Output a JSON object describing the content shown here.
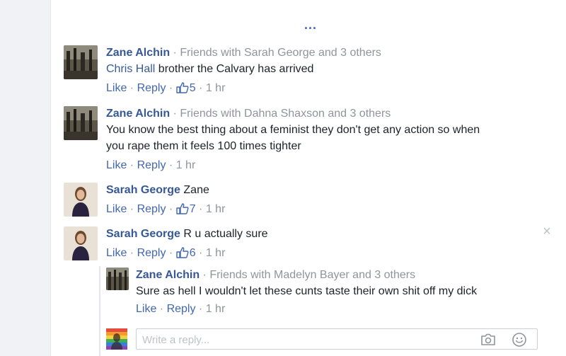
{
  "more_menu": {
    "label": "..."
  },
  "comments": [
    {
      "author": "Zane Alchin",
      "friends_text": "Friends with Sarah George and 3 others",
      "mention": "Chris Hall",
      "text": " brother the Calvary has arrived",
      "actions": {
        "like": "Like",
        "reply": "Reply",
        "likes": "5",
        "time": "1 hr"
      }
    },
    {
      "author": "Zane Alchin",
      "friends_text": "Friends with Dahna Shaxson and 3 others",
      "text_line1": "You know the best thing about a feminist they don't get any action so when",
      "text_line2": "you rape them it feels 100 times tighter",
      "actions": {
        "like": "Like",
        "reply": "Reply",
        "time": "1 hr"
      }
    },
    {
      "author": "Sarah George",
      "text": "Zane",
      "actions": {
        "like": "Like",
        "reply": "Reply",
        "likes": "7",
        "time": "1 hr"
      }
    },
    {
      "author": "Sarah George",
      "text": "R u actually sure",
      "actions": {
        "like": "Like",
        "reply": "Reply",
        "likes": "6",
        "time": "1 hr"
      }
    }
  ],
  "reply": {
    "author": "Zane Alchin",
    "friends_text": "Friends with Madelyn Bayer and 3 others",
    "text": "Sure as hell I wouldn't let these cunts taste their own shit off my dick",
    "actions": {
      "like": "Like",
      "reply": "Reply",
      "time": "1 hr"
    }
  },
  "close_label": "×",
  "reply_box": {
    "placeholder": "Write a reply..."
  },
  "separators": {
    "dot": " · "
  },
  "icons": {
    "thumb": "thumbs-up-icon",
    "camera": "camera-icon",
    "emoji": "emoji-icon",
    "close": "close-icon",
    "more": "more-dots-icon"
  },
  "colors": {
    "link": "#365899",
    "action": "#4267b2",
    "meta": "#90949c"
  }
}
